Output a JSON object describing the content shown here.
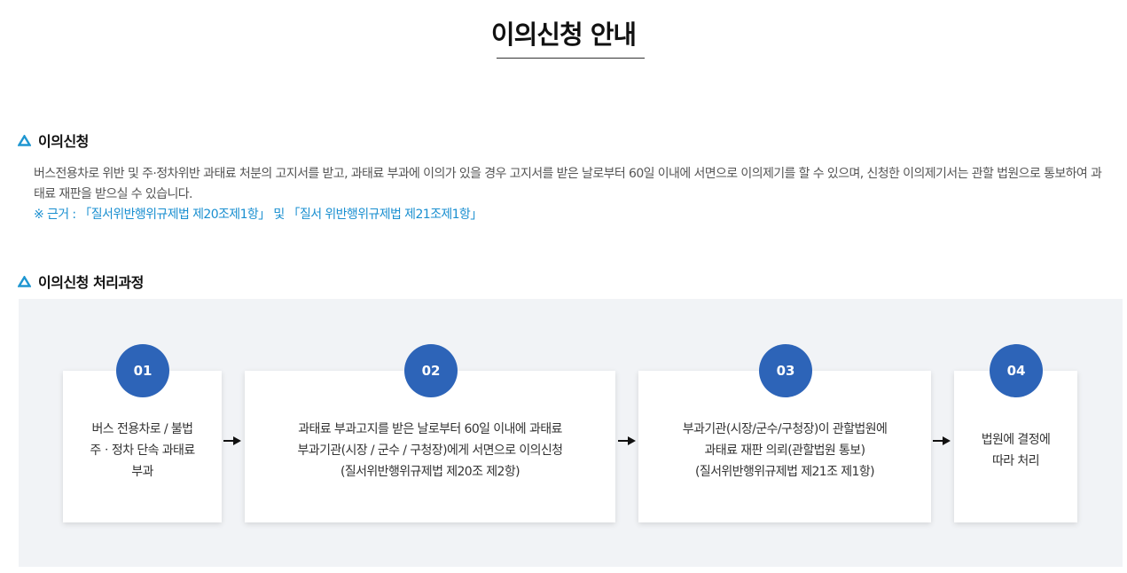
{
  "page": {
    "title": "이의신청 안내"
  },
  "section1": {
    "heading": "이의신청",
    "description": "버스전용차로 위반 및 주·정차위반 과태료 처분의 고지서를 받고, 과태료 부과에 이의가 있을 경우 고지서를 받은 날로부터 60일 이내에 서면으로 이의제기를 할 수 있으며, 신청한 이의제기서는 관할 법원으로 통보하여 과태료 재판을 받으실 수 있습니다.",
    "basis": "※ 근거 : 「질서위반행위규제법 제20조제1항」 및 「질서 위반행위규제법 제21조제1항」"
  },
  "section2": {
    "heading": "이의신청 처리과정",
    "steps": [
      {
        "number": "01",
        "text": "버스 전용차로 / 불법\n주ㆍ정차 단속 과태료\n부과"
      },
      {
        "number": "02",
        "text": "과태료 부과고지를 받은 날로부터 60일 이내에 과태료\n부과기관(시장 / 군수 / 구청장)에게 서면으로 이의신청\n(질서위반행위규제법 제20조 제2항)"
      },
      {
        "number": "03",
        "text": "부과기관(시장/군수/구청장)이 관할법원에\n과태료 재판 의뢰(관할법원 통보)\n(질서위반행위규제법 제21조 제1항)"
      },
      {
        "number": "04",
        "text": "법원에 결정에\n따라 처리"
      }
    ]
  },
  "colors": {
    "accent_circle": "#2d64b8",
    "basis_text": "#1a8fd0",
    "heading_icon": "#1e96d1",
    "process_background": "#f1f3f6"
  },
  "icons": {
    "section_heading": "triangle-outline-icon",
    "step_separator": "arrow-right-icon"
  }
}
